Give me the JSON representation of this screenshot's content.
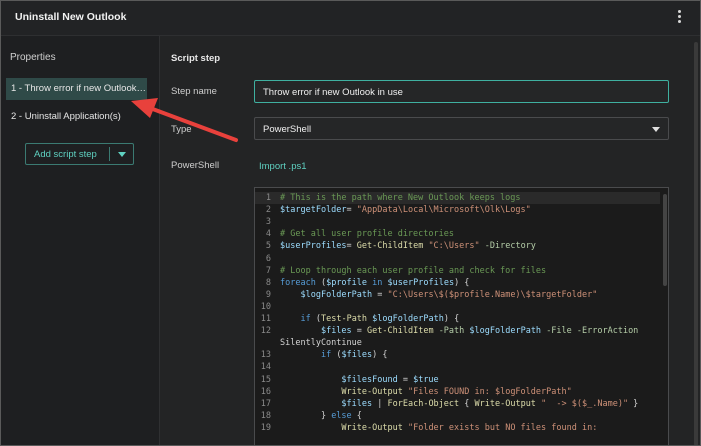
{
  "window": {
    "title": "Uninstall New Outlook"
  },
  "left_panel": {
    "heading": "Properties",
    "steps": [
      {
        "label": "1 - Throw error if new Outlook in..."
      },
      {
        "label": "2 - Uninstall Application(s)"
      }
    ],
    "add_button": "Add script step"
  },
  "right_panel": {
    "section_title": "Script step",
    "step_name_label": "Step name",
    "step_name_value": "Throw error if new Outlook in use",
    "type_label": "Type",
    "type_value": "PowerShell",
    "powershell_label": "PowerShell",
    "import_link": "Import .ps1"
  },
  "code_lines": [
    {
      "n": "1",
      "segs": [
        [
          "c-com",
          "# This is the path where New Outlook keeps logs"
        ]
      ]
    },
    {
      "n": "2",
      "segs": [
        [
          "c-var",
          "$targetFolder"
        ],
        [
          "",
          "= "
        ],
        [
          "c-str",
          "\"AppData\\Local\\Microsoft\\Olk\\Logs\""
        ]
      ]
    },
    {
      "n": "3",
      "segs": []
    },
    {
      "n": "4",
      "segs": [
        [
          "c-com",
          "# Get all user profile directories"
        ]
      ]
    },
    {
      "n": "5",
      "segs": [
        [
          "c-var",
          "$userProfiles"
        ],
        [
          "",
          "= "
        ],
        [
          "c-cmd",
          "Get-ChildItem"
        ],
        [
          "",
          " "
        ],
        [
          "c-str",
          "\"C:\\Users\""
        ],
        [
          "",
          " "
        ],
        [
          "c-par",
          "-Directory"
        ]
      ]
    },
    {
      "n": "6",
      "segs": []
    },
    {
      "n": "7",
      "segs": [
        [
          "c-com",
          "# Loop through each user profile and check for files"
        ]
      ]
    },
    {
      "n": "8",
      "segs": [
        [
          "c-kw",
          "foreach"
        ],
        [
          "",
          " ("
        ],
        [
          "c-var",
          "$profile"
        ],
        [
          "",
          " "
        ],
        [
          "c-kw",
          "in"
        ],
        [
          "",
          " "
        ],
        [
          "c-var",
          "$userProfiles"
        ],
        [
          "",
          ") {"
        ]
      ]
    },
    {
      "n": "9",
      "segs": [
        [
          "",
          "    "
        ],
        [
          "c-var",
          "$logFolderPath"
        ],
        [
          "",
          " = "
        ],
        [
          "c-str",
          "\"C:\\Users\\$($profile.Name)\\$targetFolder\""
        ]
      ]
    },
    {
      "n": "10",
      "segs": []
    },
    {
      "n": "11",
      "segs": [
        [
          "",
          "    "
        ],
        [
          "c-kw",
          "if"
        ],
        [
          "",
          " ("
        ],
        [
          "c-cmd",
          "Test-Path"
        ],
        [
          "",
          " "
        ],
        [
          "c-var",
          "$logFolderPath"
        ],
        [
          "",
          ") {"
        ]
      ]
    },
    {
      "n": "12",
      "segs": [
        [
          "",
          "        "
        ],
        [
          "c-var",
          "$files"
        ],
        [
          "",
          " = "
        ],
        [
          "c-cmd",
          "Get-ChildItem"
        ],
        [
          "",
          " "
        ],
        [
          "c-par",
          "-Path"
        ],
        [
          "",
          " "
        ],
        [
          "c-var",
          "$logFolderPath"
        ],
        [
          "",
          " "
        ],
        [
          "c-par",
          "-File -ErrorAction"
        ]
      ]
    },
    {
      "n": "",
      "segs": [
        [
          "",
          "SilentlyContinue"
        ]
      ]
    },
    {
      "n": "13",
      "segs": [
        [
          "",
          "        "
        ],
        [
          "c-kw",
          "if"
        ],
        [
          "",
          " ("
        ],
        [
          "c-var",
          "$files"
        ],
        [
          "",
          ") {"
        ]
      ]
    },
    {
      "n": "14",
      "segs": []
    },
    {
      "n": "15",
      "segs": [
        [
          "",
          "            "
        ],
        [
          "c-var",
          "$filesFound"
        ],
        [
          "",
          " = "
        ],
        [
          "c-var",
          "$true"
        ]
      ]
    },
    {
      "n": "16",
      "segs": [
        [
          "",
          "            "
        ],
        [
          "c-cmd",
          "Write-Output"
        ],
        [
          "",
          " "
        ],
        [
          "c-str",
          "\"Files FOUND in: $logFolderPath\""
        ]
      ]
    },
    {
      "n": "17",
      "segs": [
        [
          "",
          "            "
        ],
        [
          "c-var",
          "$files"
        ],
        [
          "",
          " | "
        ],
        [
          "c-cmd",
          "ForEach-Object"
        ],
        [
          "",
          " { "
        ],
        [
          "c-cmd",
          "Write-Output"
        ],
        [
          "",
          " "
        ],
        [
          "c-str",
          "\"  -> $($_.Name)\""
        ],
        [
          "",
          " }"
        ]
      ]
    },
    {
      "n": "18",
      "segs": [
        [
          "",
          "        } "
        ],
        [
          "c-kw",
          "else"
        ],
        [
          "",
          " {"
        ]
      ]
    },
    {
      "n": "19",
      "segs": [
        [
          "",
          "            "
        ],
        [
          "c-cmd",
          "Write-Output"
        ],
        [
          "",
          " "
        ],
        [
          "c-str",
          "\"Folder exists but NO files found in:"
        ]
      ]
    }
  ]
}
